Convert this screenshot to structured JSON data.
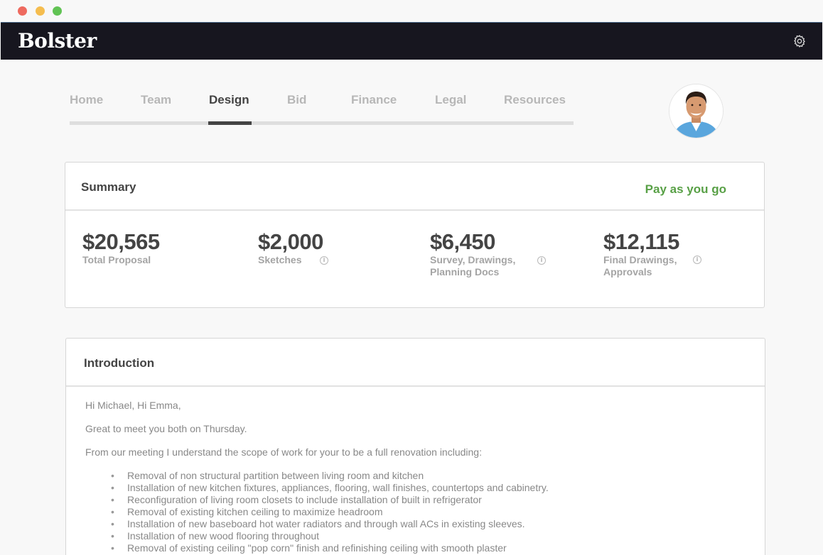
{
  "window": {
    "controls": [
      "close",
      "minimize",
      "zoom"
    ]
  },
  "appbar": {
    "logo": "Bolster",
    "settings_icon": "gear-icon"
  },
  "nav": {
    "tabs": [
      {
        "label": "Home",
        "active": false
      },
      {
        "label": "Team",
        "active": false
      },
      {
        "label": "Design",
        "active": true
      },
      {
        "label": "Bid",
        "active": false
      },
      {
        "label": "Finance",
        "active": false
      },
      {
        "label": "Legal",
        "active": false
      },
      {
        "label": "Resources",
        "active": false
      }
    ]
  },
  "summary": {
    "title": "Summary",
    "pay_link": "Pay as you go",
    "stats": [
      {
        "amount": "$20,565",
        "label": "Total Proposal"
      },
      {
        "amount": "$2,000",
        "label": "Sketches"
      },
      {
        "amount": "$6,450",
        "label": "Survey, Drawings, Planning Docs"
      },
      {
        "amount": "$12,115",
        "label": "Final Drawings, Approvals"
      }
    ]
  },
  "introduction": {
    "title": "Introduction",
    "greeting": "Hi Michael, Hi Emma,",
    "line1": "Great to meet you both on Thursday.",
    "line2": "From our meeting I understand the scope of work for your to be a full renovation including:",
    "items": [
      "Removal of non structural partition between living room and kitchen",
      "Installation of new kitchen fixtures, appliances, flooring, wall finishes, countertops and cabinetry.",
      "Reconfiguration of living room closets to include installation of built in refrigerator",
      "Removal of existing kitchen ceiling to maximize headroom",
      "Installation of new baseboard hot water radiators and through wall ACs in existing sleeves.",
      "Installation of new wood flooring throughout",
      "Removal of existing ceiling \"pop corn\" finish and refinishing ceiling with smooth plaster"
    ]
  },
  "colors": {
    "appbar": "#17161f",
    "accent_green": "#58a046",
    "active_tab": "#444444",
    "inactive_tab": "#b7b7b7"
  }
}
